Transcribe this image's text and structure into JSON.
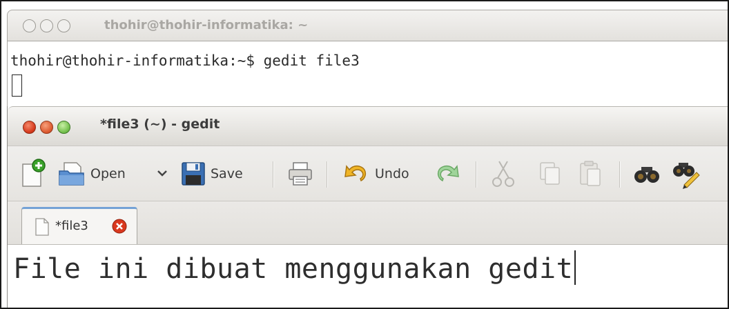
{
  "terminal": {
    "title": "thohir@thohir-informatika: ~",
    "command_line": "thohir@thohir-informatika:~$ gedit file3"
  },
  "gedit": {
    "title": "*file3 (~) - gedit",
    "toolbar": {
      "new_icon": "new-document-icon",
      "open_label": "Open",
      "save_label": "Save",
      "undo_label": "Undo"
    },
    "tab": {
      "label": "*file3"
    },
    "editor": {
      "content": "File ini dibuat menggunakan gedit"
    }
  },
  "colors": {
    "close_button": "#d6391c",
    "minimize_button": "#dc5a30",
    "maximize_button": "#74c04d",
    "tab_accent": "#74a2d6"
  }
}
